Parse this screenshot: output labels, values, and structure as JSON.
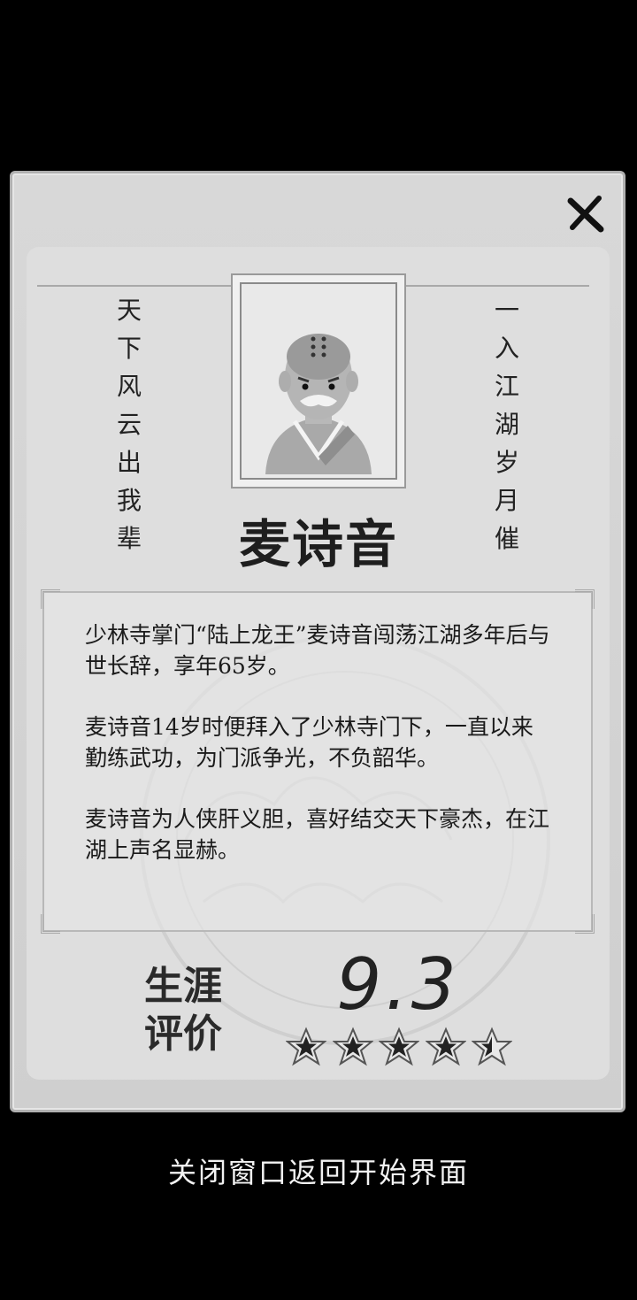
{
  "card": {
    "poem_left": [
      "天",
      "下",
      "风",
      "云",
      "出",
      "我",
      "辈"
    ],
    "poem_right": [
      "一",
      "入",
      "江",
      "湖",
      "岁",
      "月",
      "催"
    ],
    "name": "麦诗音",
    "bio": [
      "少林寺掌门“陆上龙王”麦诗音闯荡江湖多年后与世长辞，享年65岁。",
      "麦诗音14岁时便拜入了少林寺门下，一直以来勤练武功，为门派争光，不负韶华。",
      "麦诗音为人侠肝义胆，喜好结交天下豪杰，在江湖上声名显赫。"
    ],
    "career_label_line1": "生涯",
    "career_label_line2": "评价",
    "score": "9.3",
    "rating_stars": 4.5,
    "rating_max": 5
  },
  "close_icon": "close-icon",
  "bottom_link": "关闭窗口返回开始界面"
}
